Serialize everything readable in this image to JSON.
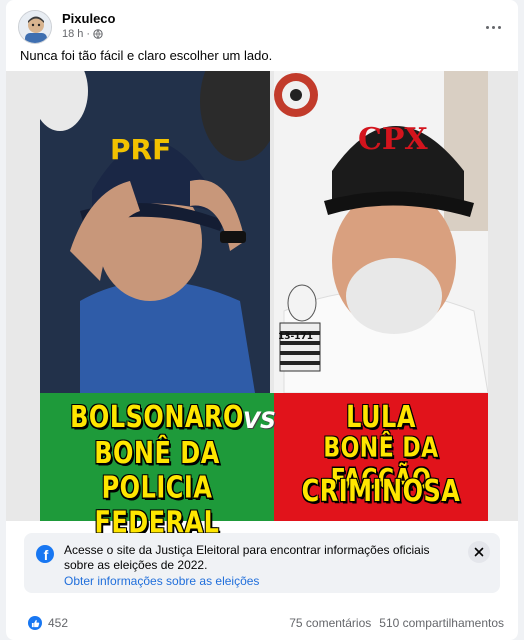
{
  "post": {
    "author": "Pixuleco",
    "time": "18 h",
    "separator": "·",
    "text": "Nunca foi tão fácil e claro escolher um lado."
  },
  "image": {
    "left_cap_text": "PRF",
    "left_label_lines": [
      "BOLSONARO",
      "BONÊ DA",
      "POLICIA FEDERAL"
    ],
    "vs_text": "VS",
    "right_cap_text": "CPX",
    "right_label_lines": [
      "LULA",
      "BONÊ DA FACÇÃO",
      "CRIMINOSA"
    ],
    "sticker_text": "13-171",
    "colors": {
      "left_band": "#1e9a3a",
      "right_band": "#e1131b",
      "label_text": "#ffe600"
    }
  },
  "info_box": {
    "icon": "facebook-icon",
    "text": "Acesse o site da Justiça Eleitoral para encontrar informações oficiais sobre as eleições de 2022.",
    "link": "Obter informações sobre as eleições"
  },
  "engagement": {
    "reactions": "452",
    "comments": "75 comentários",
    "shares": "510 compartilhamentos"
  }
}
